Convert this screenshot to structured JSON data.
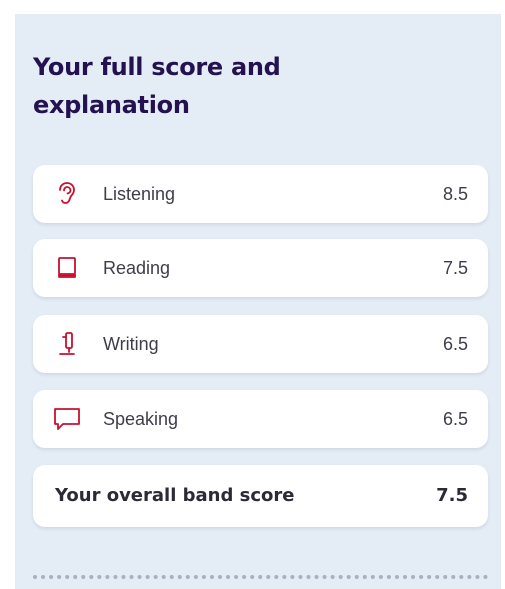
{
  "header": {
    "title": "Your full score and explanation"
  },
  "scores": [
    {
      "label": "Listening",
      "value": "8.5",
      "icon": "ear-icon"
    },
    {
      "label": "Reading",
      "value": "7.5",
      "icon": "book-icon"
    },
    {
      "label": "Writing",
      "value": "6.5",
      "icon": "pen-icon"
    },
    {
      "label": "Speaking",
      "value": "6.5",
      "icon": "speech-bubble-icon"
    }
  ],
  "overall": {
    "label": "Your overall band score",
    "value": "7.5"
  },
  "colors": {
    "panel_background": "#e4ecf6",
    "title": "#23124f",
    "icon_accent": "#c8102e"
  }
}
